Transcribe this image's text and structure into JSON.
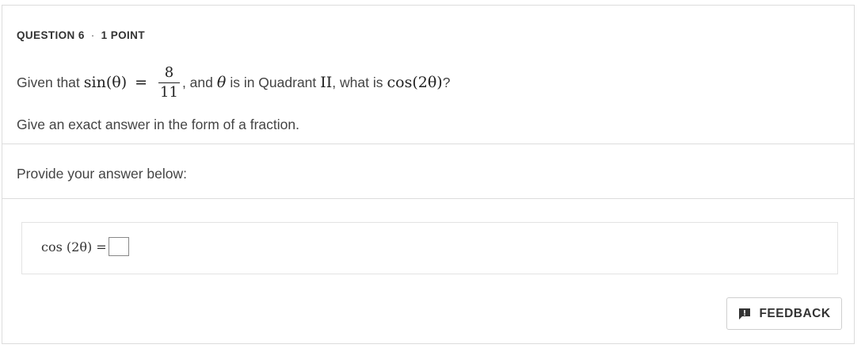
{
  "question": {
    "number_label": "QUESTION 6",
    "separator": "·",
    "points_label": "1 POINT"
  },
  "prompt": {
    "given_that": "Given that",
    "sin_expr": "sin(θ)",
    "equals": "=",
    "numerator": "8",
    "denominator": "11",
    "after_fraction": ", and",
    "theta": "θ",
    "is_in_quadrant": "is in Quadrant",
    "quadrant": "II",
    "what_is": ", what is",
    "cos_expr": "cos(2θ)",
    "question_mark": "?"
  },
  "instruction": "Give an exact answer in the form of a fraction.",
  "answer_section": {
    "heading": "Provide your answer below:",
    "expression": "cos (2θ) =",
    "input_value": ""
  },
  "feedback": {
    "label": "FEEDBACK",
    "icon": "comment-exclamation-icon"
  }
}
